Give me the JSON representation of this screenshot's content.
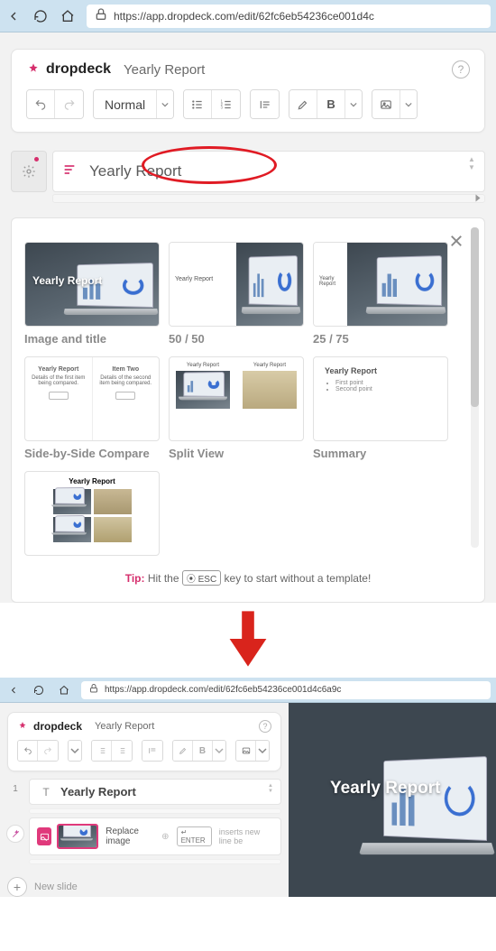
{
  "browser1": {
    "url": "https://app.dropdeck.com/edit/62fc6eb54236ce001d4c"
  },
  "browser2": {
    "url": "https://app.dropdeck.com/edit/62fc6eb54236ce001d4c6a9c"
  },
  "app": {
    "brand": "dropdeck",
    "title": "Yearly Report",
    "styleSelector": "Normal",
    "bold": "B",
    "help": "?"
  },
  "editor": {
    "titleValue": "Yearly Report"
  },
  "templates": {
    "t1": {
      "overlay": "Yearly Report",
      "label": "Image and title"
    },
    "t2": {
      "mini": "Yearly Report",
      "label": "50 / 50"
    },
    "t3": {
      "mini": "Yearly Report",
      "label": "25 / 75"
    },
    "t4": {
      "col1h": "Yearly Report",
      "col1d": "Details of the first item being compared.",
      "col2h": "Item Two",
      "col2d": "Details of the second item being compared.",
      "label": "Side-by-Side Compare"
    },
    "t5": {
      "cap": "Yearly Report",
      "label": "Split View"
    },
    "t6": {
      "h": "Yearly Report",
      "p1": "First point",
      "p2": "Second point",
      "label": "Summary"
    },
    "t7": {
      "h": "Yearly Report"
    }
  },
  "tip": {
    "prefix": "Tip:",
    "before": "Hit the",
    "key": "⦿ ESC",
    "after": "key to start without a template!"
  },
  "slide": {
    "num": "1",
    "title": "Yearly Report",
    "replace": "Replace image",
    "enter": "↵ ENTER",
    "hint": "inserts new line be",
    "newslide": "New slide"
  },
  "preview": {
    "title": "Yearly Report"
  }
}
